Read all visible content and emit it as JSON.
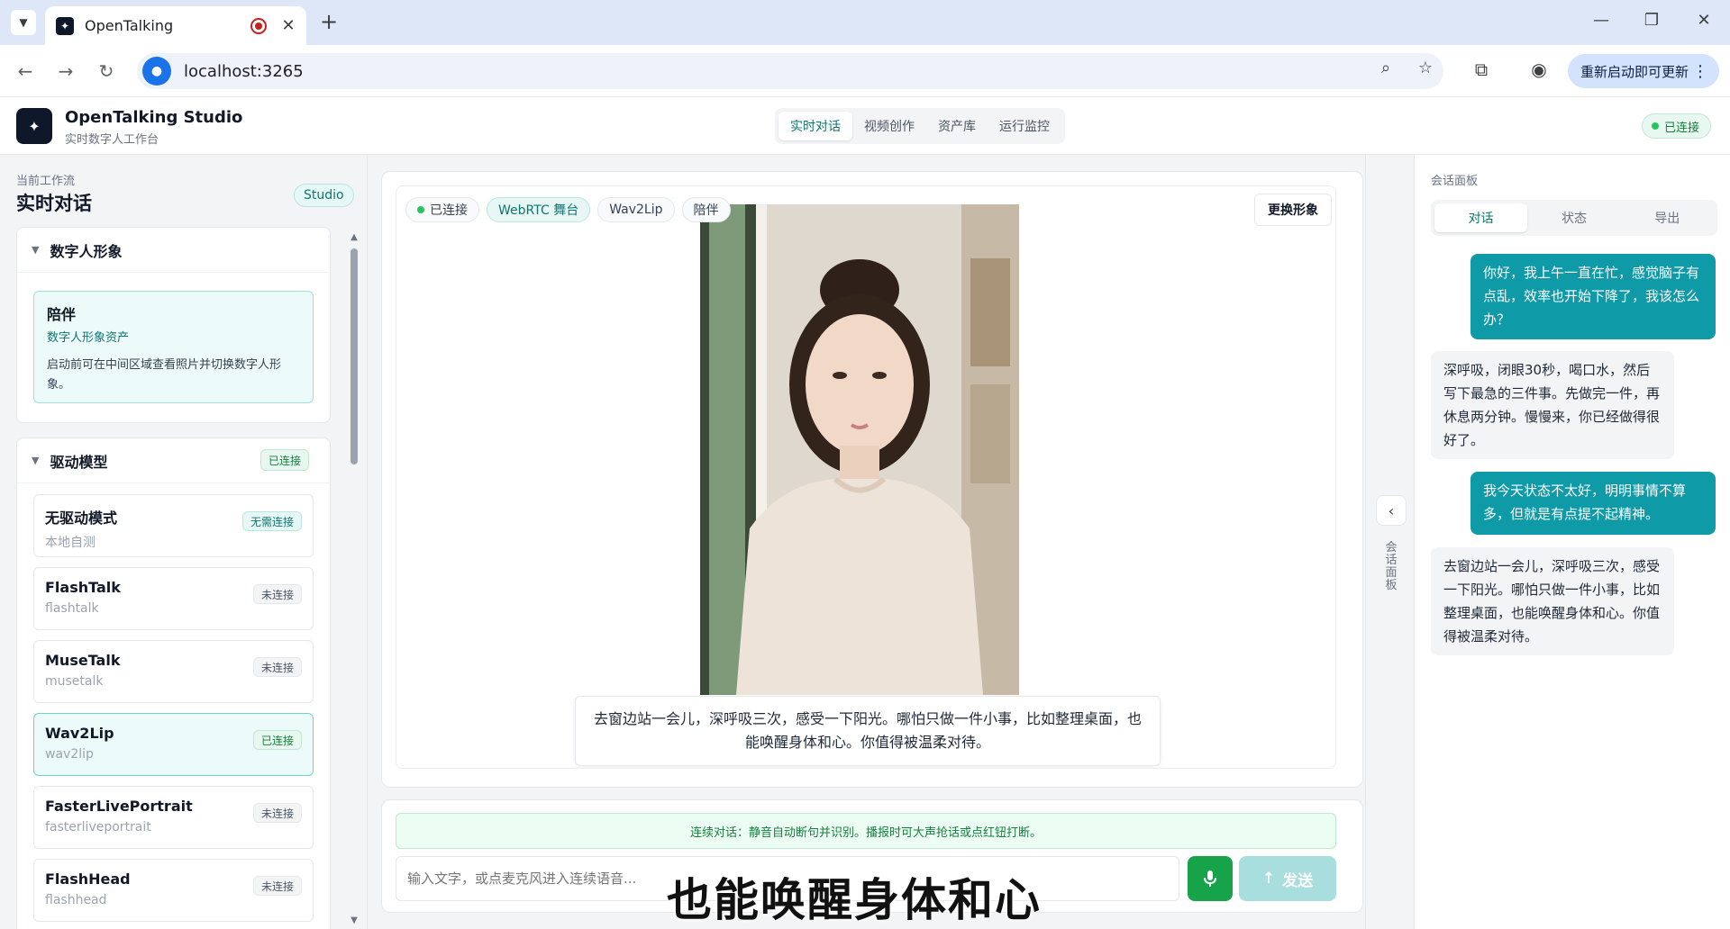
{
  "browser": {
    "tab_title": "OpenTalking",
    "url": "localhost:3265",
    "update_button": "重新启动即可更新"
  },
  "header": {
    "brand_title": "OpenTalking Studio",
    "brand_subtitle": "实时数字人工作台",
    "nav": [
      "实时对话",
      "视频创作",
      "资产库",
      "运行监控"
    ],
    "connection_status": "已连接"
  },
  "sidebar": {
    "workflow_label": "当前工作流",
    "workflow_title": "实时对话",
    "studio_badge": "Studio",
    "avatar_section": {
      "title": "数字人形象",
      "card_name": "陪伴",
      "card_type": "数字人形象资产",
      "card_desc": "启动前可在中间区域查看照片并切换数字人形象。"
    },
    "driver_section": {
      "title": "驱动模型",
      "status": "已连接",
      "models": [
        {
          "name": "无驱动模式",
          "id": "本地自测",
          "status": "无需连接"
        },
        {
          "name": "FlashTalk",
          "id": "flashtalk",
          "status": "未连接"
        },
        {
          "name": "MuseTalk",
          "id": "musetalk",
          "status": "未连接"
        },
        {
          "name": "Wav2Lip",
          "id": "wav2lip",
          "status": "已连接"
        },
        {
          "name": "FasterLivePortrait",
          "id": "fasterliveportrait",
          "status": "未连接"
        },
        {
          "name": "FlashHead",
          "id": "flashhead",
          "status": "未连接"
        }
      ]
    }
  },
  "stage": {
    "chips": [
      "已连接",
      "WebRTC 舞台",
      "Wav2Lip",
      "陪伴"
    ],
    "change_avatar": "更换形象",
    "subtitle": "去窗边站一会儿，深呼吸三次，感受一下阳光。哪怕只做一件小事，比如整理桌面，也能唤醒身体和心。你值得被温柔对待。"
  },
  "composer": {
    "hint": "连续对话：静音自动断句并识别。播报时可大声抢话或点红钮打断。",
    "placeholder": "输入文字，或点麦克风进入连续语音...",
    "send": "发送",
    "caption": "也能唤醒身体和心"
  },
  "rail": {
    "label": "会话面板"
  },
  "session": {
    "label": "会话面板",
    "tabs": [
      "对话",
      "状态",
      "导出"
    ],
    "messages": [
      {
        "role": "user",
        "text": "你好，我上午一直在忙，感觉脑子有点乱，效率也开始下降了，我该怎么办？"
      },
      {
        "role": "bot",
        "text": "深呼吸，闭眼30秒，喝口水，然后写下最急的三件事。先做完一件，再休息两分钟。慢慢来，你已经做得很好了。"
      },
      {
        "role": "user",
        "text": "我今天状态不太好，明明事情不算多，但就是有点提不起精神。"
      },
      {
        "role": "bot",
        "text": "去窗边站一会儿，深呼吸三次，感受一下阳光。哪怕只做一件小事，比如整理桌面，也能唤醒身体和心。你值得被温柔对待。"
      }
    ]
  }
}
